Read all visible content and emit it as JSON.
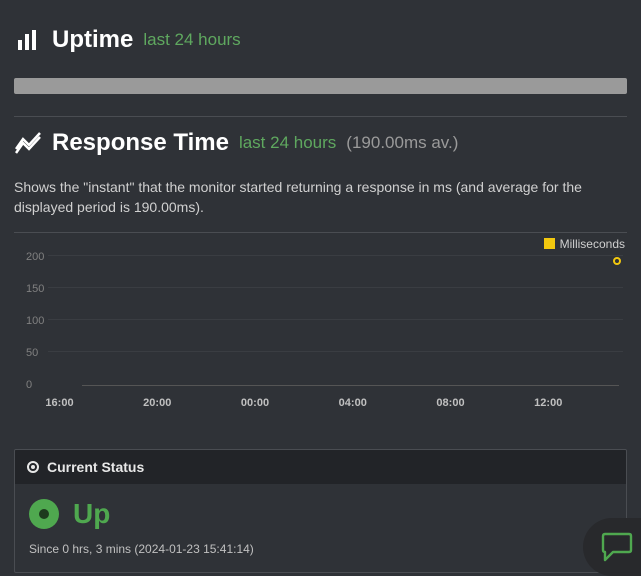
{
  "uptime": {
    "title": "Uptime",
    "period": "last 24 hours"
  },
  "response": {
    "title": "Response Time",
    "period": "last 24 hours",
    "average_label": "(190.00ms av.)",
    "description": "Shows the \"instant\" that the monitor started returning a response in ms (and average for the displayed period is 190.00ms)."
  },
  "chart_data": {
    "type": "scatter",
    "title": "",
    "xlabel": "",
    "ylabel": "",
    "ylim": [
      0,
      200
    ],
    "y_ticks": [
      0,
      50,
      100,
      150,
      200
    ],
    "x_ticks": [
      "16:00",
      "20:00",
      "00:00",
      "04:00",
      "08:00",
      "12:00"
    ],
    "legend": "Milliseconds",
    "series": [
      {
        "name": "Milliseconds",
        "points": [
          {
            "x": "15:41",
            "y": 190
          }
        ]
      }
    ]
  },
  "status": {
    "header": "Current Status",
    "state": "Up",
    "since": "Since 0 hrs, 3 mins (2024-01-23 15:41:14)"
  }
}
